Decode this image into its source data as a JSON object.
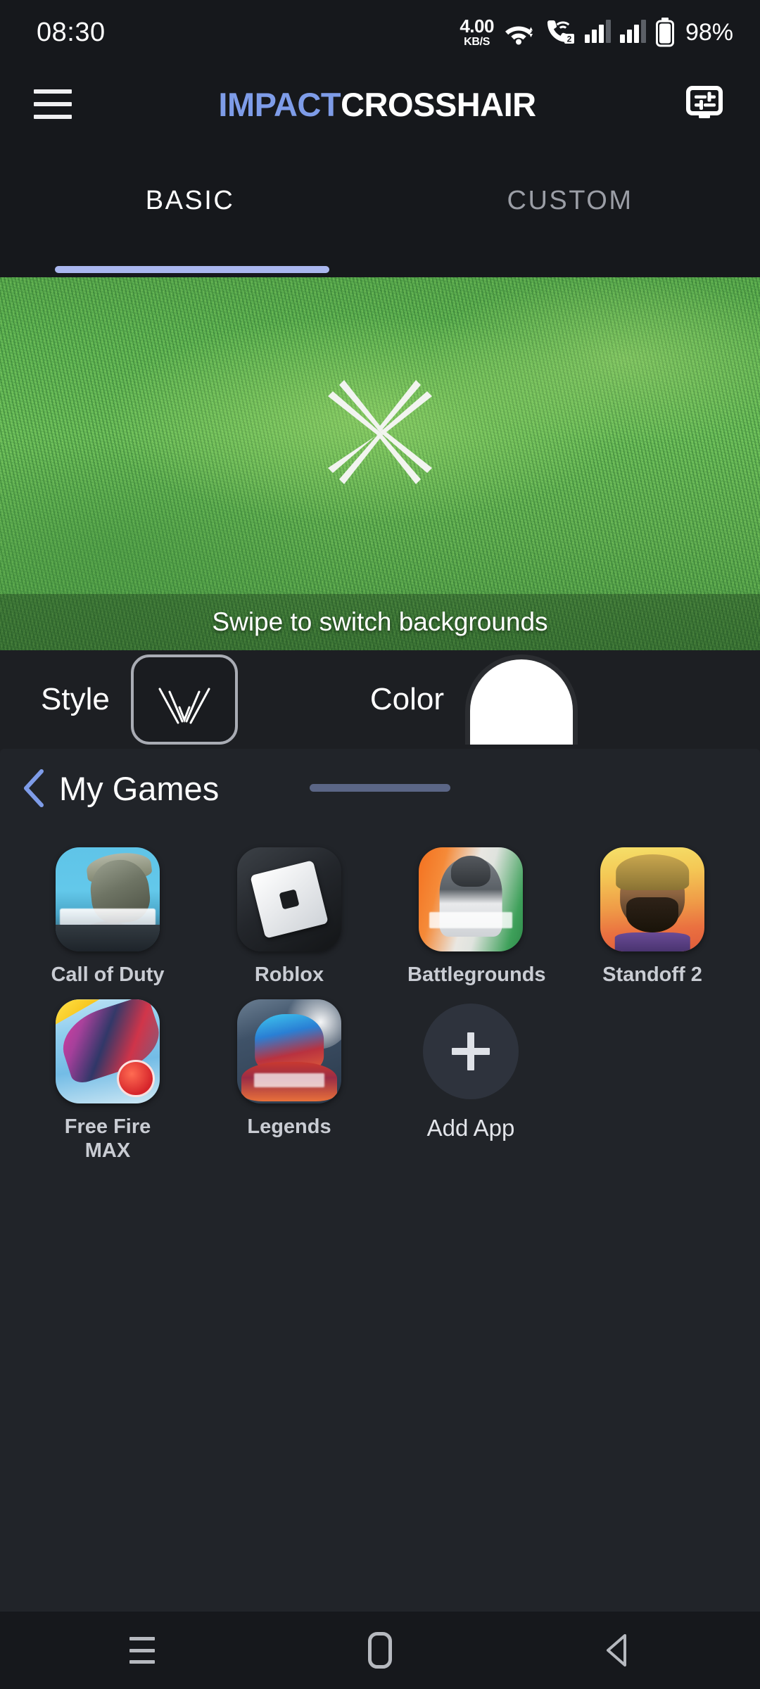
{
  "status_bar": {
    "clock": "08:30",
    "net_speed_value": "4.00",
    "net_speed_unit": "KB/S",
    "wifi_icon": "wifi-icon",
    "call_icon": "vowifi-call-icon",
    "sim_badge": "2",
    "signal_icon_1": "signal-bars-icon",
    "signal_icon_2": "signal-bars-icon",
    "battery_icon": "battery-icon",
    "battery_text": "98%"
  },
  "app_bar": {
    "menu_icon": "hamburger-menu-icon",
    "brand_primary": "IMPACT",
    "brand_secondary": "CROSSHAIR",
    "brand_primary_color": "#7e9ce8",
    "brand_secondary_color": "#ffffff",
    "display_settings_icon": "monitor-sliders-icon"
  },
  "tabs": {
    "items": [
      {
        "label": "BASIC",
        "active": true
      },
      {
        "label": "CUSTOM",
        "active": false
      }
    ],
    "indicator_color": "#aab7ef"
  },
  "preview": {
    "background_name": "grass-field",
    "crosshair_name": "x-star-crosshair",
    "crosshair_color": "#f2f4f0",
    "hint_text": "Swipe to switch backgrounds"
  },
  "controls": {
    "style_label": "Style",
    "style_swatch_icon": "crosshair-style-preview",
    "color_label": "Color",
    "color_swatch_value": "#ffffff"
  },
  "sheet": {
    "back_icon": "back-chevron-icon",
    "back_icon_color": "#7e9ce8",
    "title": "My Games",
    "drag_handle": "drag-handle",
    "games": [
      {
        "label": "Call of Duty",
        "icon": "call-of-duty-icon",
        "art": "ic-cod"
      },
      {
        "label": "Roblox",
        "icon": "roblox-icon",
        "art": "ic-roblox"
      },
      {
        "label": "Battlegrounds",
        "icon": "battlegrounds-icon",
        "art": "ic-bgmi"
      },
      {
        "label": "Standoff 2",
        "icon": "standoff-2-icon",
        "art": "ic-standoff"
      },
      {
        "label": "Free Fire MAX",
        "icon": "free-fire-max-icon",
        "art": "ic-ffmax"
      },
      {
        "label": "Legends",
        "icon": "legends-icon",
        "art": "ic-legends"
      }
    ],
    "add_app": {
      "label": "Add App",
      "icon": "plus-icon"
    }
  },
  "nav_bar": {
    "recents_icon": "recents-icon",
    "home_icon": "home-icon",
    "back_icon": "back-triangle-icon"
  },
  "theme": {
    "page_bg": "#1d1f23",
    "chrome_bg": "#16181c",
    "sheet_bg": "#212429",
    "accent": "#7e9ce8"
  }
}
